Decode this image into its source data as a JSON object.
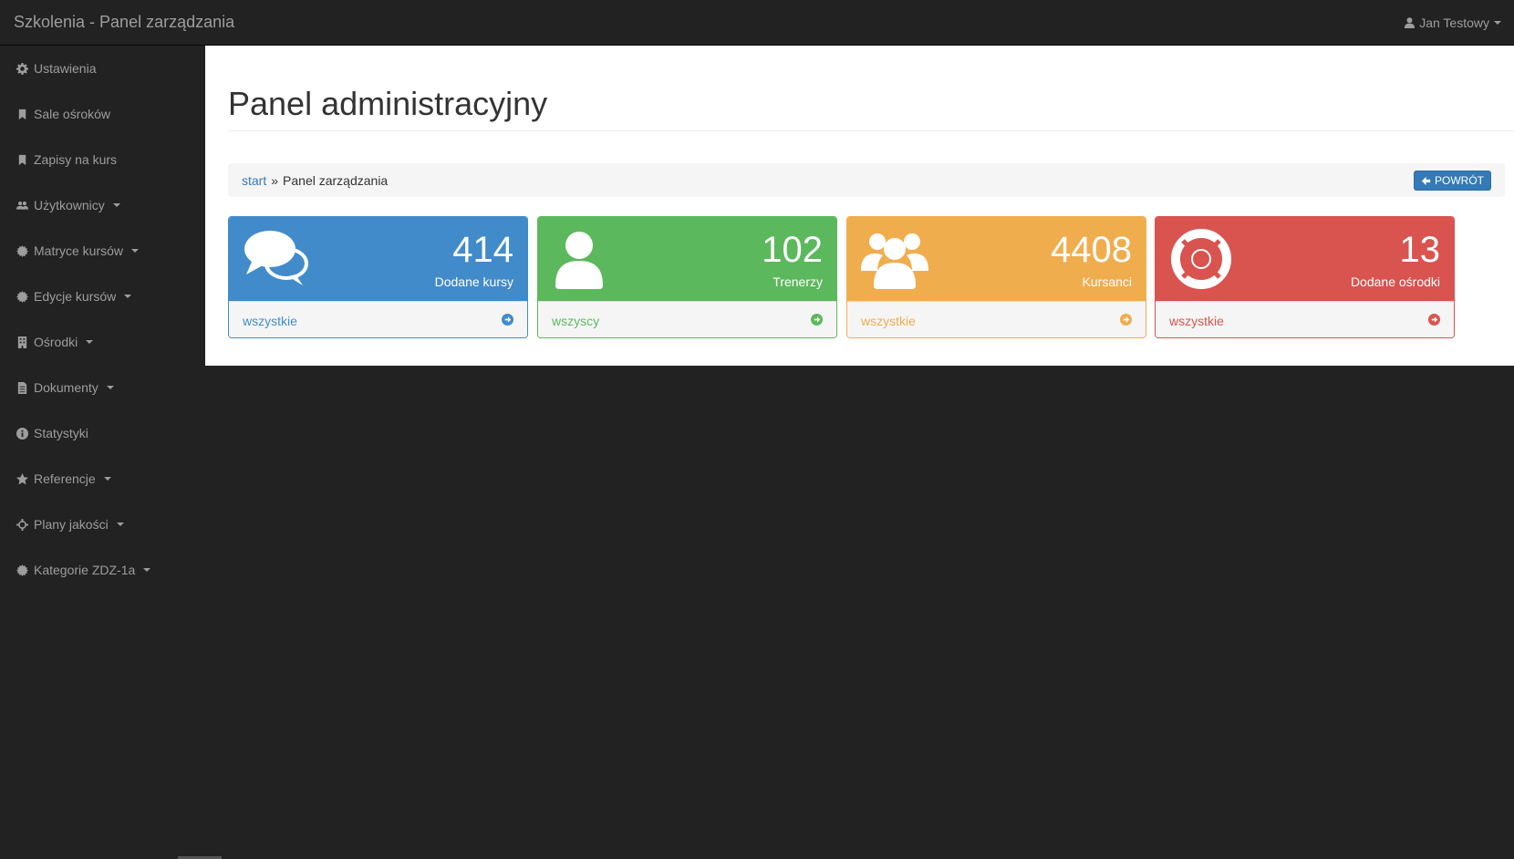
{
  "app": {
    "brand": "Szkolenia - Panel zarządzania",
    "user": "Jan Testowy"
  },
  "sidebar": {
    "items": [
      {
        "label": "Ustawienia",
        "icon": "gear-icon",
        "dropdown": false
      },
      {
        "label": "Sale ośroków",
        "icon": "bookmark-icon",
        "dropdown": false
      },
      {
        "label": "Zapisy na kurs",
        "icon": "bookmark-icon",
        "dropdown": false
      },
      {
        "label": "Użytkownicy",
        "icon": "users-icon",
        "dropdown": true
      },
      {
        "label": "Matryce kursów",
        "icon": "cog-icon",
        "dropdown": true
      },
      {
        "label": "Edycje kursów",
        "icon": "cog-icon",
        "dropdown": true
      },
      {
        "label": "Ośrodki",
        "icon": "building-icon",
        "dropdown": true
      },
      {
        "label": "Dokumenty",
        "icon": "document-icon",
        "dropdown": true
      },
      {
        "label": "Statystyki",
        "icon": "info-icon",
        "dropdown": false
      },
      {
        "label": "Referencje",
        "icon": "star-icon",
        "dropdown": true
      },
      {
        "label": "Plany jakości",
        "icon": "crosshair-icon",
        "dropdown": true
      },
      {
        "label": "Kategorie ZDZ-1a",
        "icon": "cog-icon",
        "dropdown": true
      }
    ]
  },
  "main": {
    "title": "Panel administracyjny",
    "breadcrumb": {
      "start": "start",
      "separator": "»",
      "current": "Panel zarządzania"
    },
    "back_label": "POWRÓT"
  },
  "cards": [
    {
      "value": "414",
      "label": "Dodane kursy",
      "link": "wszystkie",
      "icon": "comments-icon",
      "color": "#428bca",
      "border": "#428bca"
    },
    {
      "value": "102",
      "label": "Trenerzy",
      "link": "wszyscy",
      "icon": "user-icon",
      "color": "#5cb85c",
      "border": "#5cb85c"
    },
    {
      "value": "4408",
      "label": "Kursanci",
      "link": "wszystkie",
      "icon": "group-icon",
      "color": "#f0ad4e",
      "border": "#f0ad4e"
    },
    {
      "value": "13",
      "label": "Dodane ośrodki",
      "link": "wszystkie",
      "icon": "life-ring-icon",
      "color": "#d9534f",
      "border": "#d9534f"
    }
  ]
}
